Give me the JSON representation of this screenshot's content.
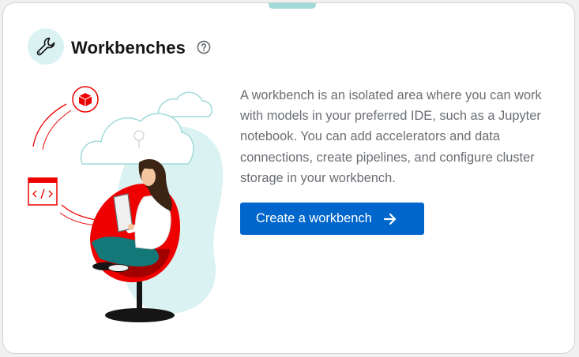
{
  "card": {
    "title": "Workbenches",
    "description": "A workbench is an isolated area where you can work with models in your preferred IDE, such as a Jupyter notebook. You can add accelerators and data connections, create pipelines, and configure cluster storage in your workbench.",
    "cta_label": "Create a workbench",
    "header_icon": "wrench-icon",
    "help_icon": "help-circle-icon",
    "cta_icon": "arrow-right-icon"
  },
  "colors": {
    "primary": "#0066cc",
    "accent_teal": "#daf2f2",
    "title": "#151515",
    "body_text": "#6a6e73",
    "illustration_red": "#ee0000"
  }
}
